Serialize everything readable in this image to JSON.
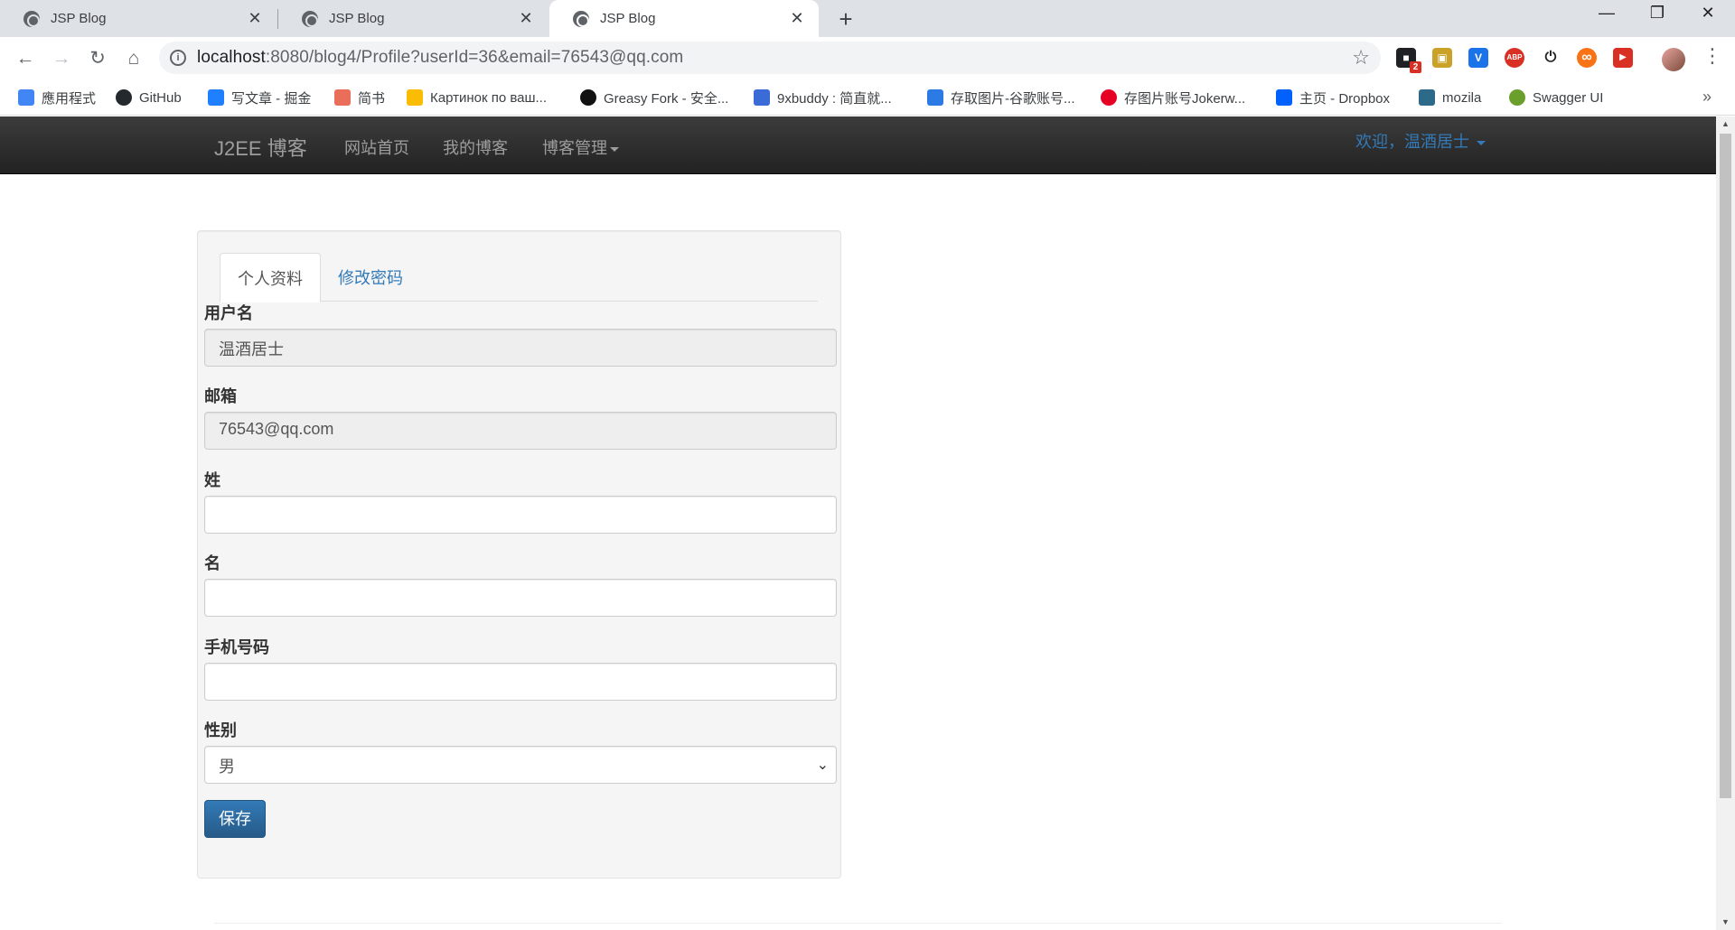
{
  "browser": {
    "tabs": [
      {
        "title": "JSP Blog",
        "close": "✕"
      },
      {
        "title": "JSP Blog",
        "close": "✕"
      },
      {
        "title": "JSP Blog",
        "close": "✕"
      }
    ],
    "new_tab": "+",
    "window_controls": {
      "minimize": "—",
      "restore": "❐",
      "close": "✕"
    },
    "nav": {
      "back": "←",
      "forward": "→",
      "reload": "↻",
      "home": "⌂"
    },
    "address": {
      "host": "localhost",
      "path": ":8080/blog4/Profile?userId=36&email=76543@qq.com",
      "info": "i",
      "star": "☆"
    },
    "extensions": [
      {
        "name": "extension-icon",
        "label": "■",
        "badge": "2",
        "color": "#202124"
      },
      {
        "name": "image-extension-icon",
        "label": "▣",
        "color": "#c9a227"
      },
      {
        "name": "vimeo-extension-icon",
        "label": "V",
        "color": "#1a73e8"
      },
      {
        "name": "adblock-icon",
        "label": "ABP",
        "color": "#d93025"
      },
      {
        "name": "power-icon",
        "label": "⏻",
        "color": "#202124"
      },
      {
        "name": "infinity-icon",
        "label": "∞",
        "color": "#f97316"
      },
      {
        "name": "youtube-icon",
        "label": "▶",
        "color": "#d93025"
      }
    ],
    "menu": "⋮",
    "bookmarks": [
      {
        "label": "應用程式",
        "color": "#4285f4"
      },
      {
        "label": "GitHub",
        "color": "#24292e"
      },
      {
        "label": "写文章 - 掘金",
        "color": "#1e80ff"
      },
      {
        "label": "简书",
        "color": "#ea6f5a"
      },
      {
        "label": "Картинок по ваш...",
        "color": "#fbbc04"
      },
      {
        "label": "Greasy Fork - 安全...",
        "color": "#111"
      },
      {
        "label": "9xbuddy : 简直就...",
        "color": "#3b6bd6"
      },
      {
        "label": "存取图片-谷歌账号...",
        "color": "#2c7be5"
      },
      {
        "label": "存图片账号Jokerw...",
        "color": "#e60023"
      },
      {
        "label": "主页 - Dropbox",
        "color": "#0061ff"
      },
      {
        "label": "mozila",
        "color": "#2d6a8a"
      },
      {
        "label": "Swagger UI",
        "color": "#6a9f2b"
      }
    ],
    "bookmarks_more": "»"
  },
  "navbar": {
    "brand": "J2EE 博客",
    "links": [
      "网站首页",
      "我的博客",
      "博客管理"
    ],
    "user": "欢迎，温酒居士"
  },
  "profile": {
    "tabs": [
      "个人资料",
      "修改密码"
    ],
    "fields": [
      {
        "label": "用户名",
        "value": "温酒居士"
      },
      {
        "label": "邮箱",
        "value": "76543@qq.com"
      },
      {
        "label": "姓",
        "value": ""
      },
      {
        "label": "名",
        "value": ""
      },
      {
        "label": "手机号码",
        "value": ""
      },
      {
        "label": "性别",
        "value": "男"
      }
    ],
    "select_chevron": "⌄",
    "save": "保存"
  },
  "scrollbar": {
    "up": "▲",
    "down": "▼"
  }
}
